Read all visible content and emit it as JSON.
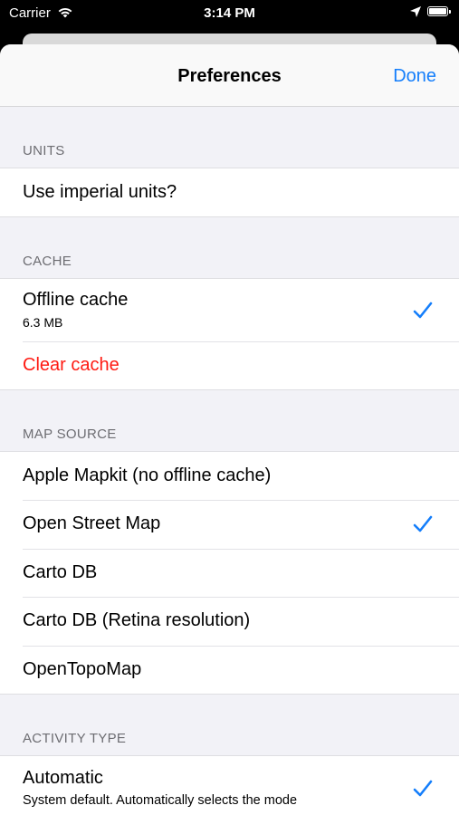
{
  "status_bar": {
    "carrier": "Carrier",
    "time": "3:14 PM",
    "wifi_icon": "wifi-icon",
    "location_icon": "location-arrow-icon",
    "battery_icon": "battery-icon"
  },
  "nav": {
    "title": "Preferences",
    "done_label": "Done"
  },
  "colors": {
    "accent": "#147efb",
    "destructive": "#ff1a12",
    "section_text": "#6d6d72",
    "background": "#f2f2f7"
  },
  "sections": {
    "units": {
      "header": "UNITS",
      "rows": [
        {
          "title": "Use imperial units?"
        }
      ]
    },
    "cache": {
      "header": "CACHE",
      "rows": [
        {
          "title": "Offline cache",
          "subtitle": "6.3 MB",
          "checked": true
        },
        {
          "title": "Clear cache",
          "destructive": true
        }
      ]
    },
    "map_source": {
      "header": "MAP SOURCE",
      "rows": [
        {
          "title": "Apple Mapkit (no offline cache)",
          "checked": false
        },
        {
          "title": "Open Street Map",
          "checked": true
        },
        {
          "title": "Carto DB",
          "checked": false
        },
        {
          "title": "Carto DB (Retina resolution)",
          "checked": false
        },
        {
          "title": "OpenTopoMap",
          "checked": false
        }
      ]
    },
    "activity_type": {
      "header": "ACTIVITY TYPE",
      "rows": [
        {
          "title": "Automatic",
          "subtitle": "System default. Automatically selects the mode",
          "checked": true
        }
      ]
    }
  }
}
